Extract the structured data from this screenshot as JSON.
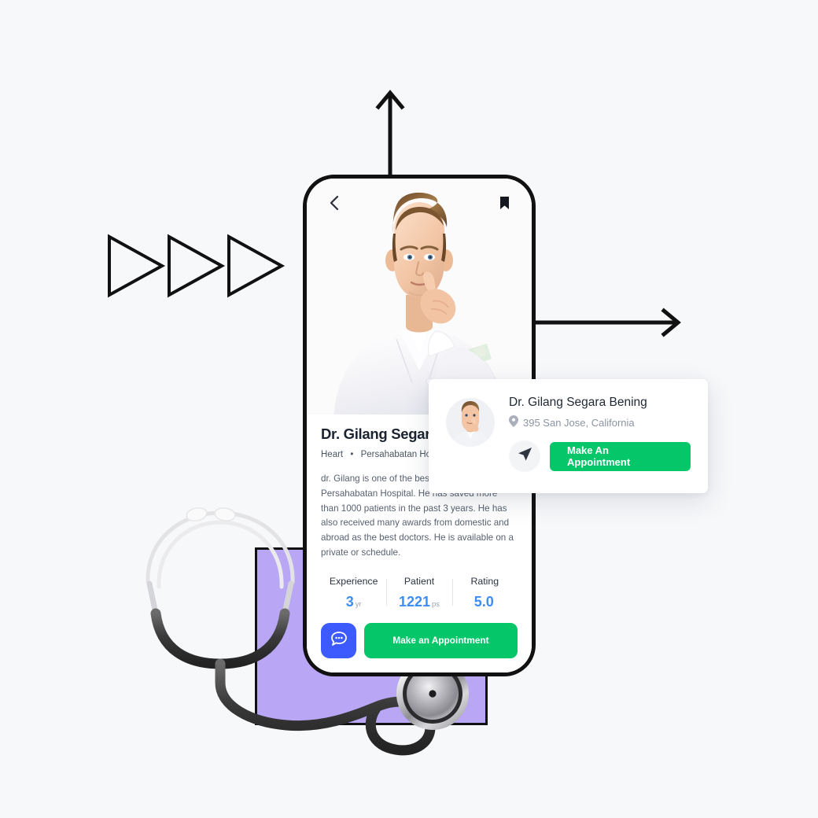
{
  "scene": {
    "background_color": "#f7f8fa",
    "accent_green": "#05c76a",
    "accent_blue": "#3d5afe",
    "stat_blue": "#3d8ef0",
    "purple_block": "#b9a6f4",
    "outline_color": "#111111"
  },
  "decorations": {
    "triangles_label": "play-triangles",
    "arrow_up_label": "up-arrow",
    "arrow_right_label": "right-arrow",
    "purple_block_label": "purple-block",
    "stethoscope_label": "stethoscope"
  },
  "phone": {
    "topbar": {
      "back_icon": "chevron-left-icon",
      "bookmark_icon": "bookmark-icon"
    },
    "hero": {
      "photo_alt": "doctor-portrait"
    },
    "doctor": {
      "name": "Dr. Gilang Segara Bening",
      "specialty": "Heart",
      "separator": "•",
      "hospital": "Persahabatan Hospital",
      "bio": "dr. Gilang is one of the best doctors at Persahabatan Hospital. He has saved more than 1000 patients in the past 3 years. He has also received many awards from domestic and abroad as the best doctors. He is available on a private or schedule."
    },
    "stats": [
      {
        "label": "Experience",
        "value": "3",
        "unit": "yr"
      },
      {
        "label": "Patient",
        "value": "1221",
        "unit": "ps"
      },
      {
        "label": "Rating",
        "value": "5.0",
        "unit": ""
      }
    ],
    "actions": {
      "chat_icon": "chat-bubble-icon",
      "appointment_label": "Make an Appointment"
    }
  },
  "floating_card": {
    "avatar_alt": "doctor-avatar",
    "name": "Dr. Gilang Segara Bening",
    "location_icon": "map-pin-icon",
    "location": "395 San Jose, California",
    "send_icon": "send-icon",
    "appointment_label": "Make An Appointment"
  }
}
